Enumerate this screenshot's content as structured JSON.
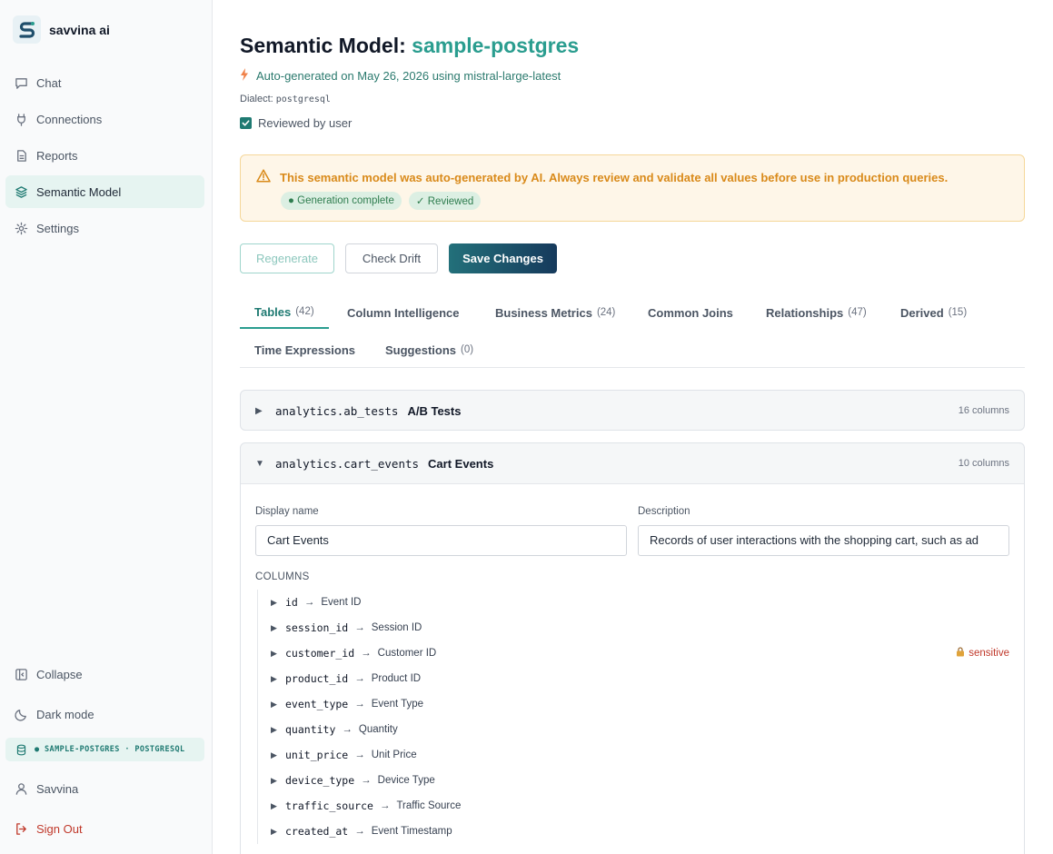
{
  "brand": {
    "name": "savvina ai"
  },
  "nav": [
    {
      "label": "Chat",
      "icon": "chat-icon"
    },
    {
      "label": "Connections",
      "icon": "plug-icon"
    },
    {
      "label": "Reports",
      "icon": "document-icon"
    },
    {
      "label": "Semantic Model",
      "icon": "layers-icon",
      "active": true
    },
    {
      "label": "Settings",
      "icon": "gear-icon"
    }
  ],
  "sidebar_bottom": {
    "collapse": "Collapse",
    "dark_mode": "Dark mode",
    "connection": "● SAMPLE-POSTGRES · POSTGRESQL",
    "user": "Savvina",
    "sign_out": "Sign Out"
  },
  "header": {
    "title_prefix": "Semantic Model:",
    "title_accent": "sample-postgres",
    "generated": "Auto-generated on May 26, 2026 using mistral-large-latest",
    "dialect_label": "Dialect:",
    "dialect_value": "postgresql",
    "reviewed_label": "Reviewed by user"
  },
  "alert": {
    "message": "This semantic model was auto-generated by AI. Always review and validate all values before use in production queries.",
    "badges": [
      "● Generation complete",
      "✓ Reviewed"
    ]
  },
  "actions": {
    "regenerate": "Regenerate",
    "check_drift": "Check Drift",
    "save": "Save Changes"
  },
  "tabs": [
    {
      "label": "Tables",
      "count": "(42)"
    },
    {
      "label": "Column Intelligence",
      "count": ""
    },
    {
      "label": "Business Metrics",
      "count": "(24)"
    },
    {
      "label": "Common Joins",
      "count": ""
    },
    {
      "label": "Relationships",
      "count": "(47)"
    },
    {
      "label": "Derived",
      "count": "(15)"
    },
    {
      "label": "Time Expressions",
      "count": ""
    },
    {
      "label": "Suggestions",
      "count": "(0)"
    }
  ],
  "tables": [
    {
      "name": "analytics.ab_tests",
      "label": "A/B Tests",
      "columns": "16 columns",
      "expanded": false
    },
    {
      "name": "analytics.cart_events",
      "label": "Cart Events",
      "columns": "10 columns",
      "expanded": true
    }
  ],
  "detail": {
    "display_name_label": "Display name",
    "display_name_value": "Cart Events",
    "description_label": "Description",
    "description_value": "Records of user interactions with the shopping cart, such as ad",
    "columns_title": "COLUMNS",
    "sensitive_label": "sensitive",
    "columns": [
      {
        "name": "id",
        "label": "Event ID"
      },
      {
        "name": "session_id",
        "label": "Session ID"
      },
      {
        "name": "customer_id",
        "label": "Customer ID",
        "sensitive": true
      },
      {
        "name": "product_id",
        "label": "Product ID"
      },
      {
        "name": "event_type",
        "label": "Event Type"
      },
      {
        "name": "quantity",
        "label": "Quantity"
      },
      {
        "name": "unit_price",
        "label": "Unit Price"
      },
      {
        "name": "device_type",
        "label": "Device Type"
      },
      {
        "name": "traffic_source",
        "label": "Traffic Source"
      },
      {
        "name": "created_at",
        "label": "Event Timestamp"
      }
    ]
  },
  "colors": {
    "accent": "#2a9d8f",
    "warning": "#d98a1a",
    "danger": "#c0392b"
  }
}
